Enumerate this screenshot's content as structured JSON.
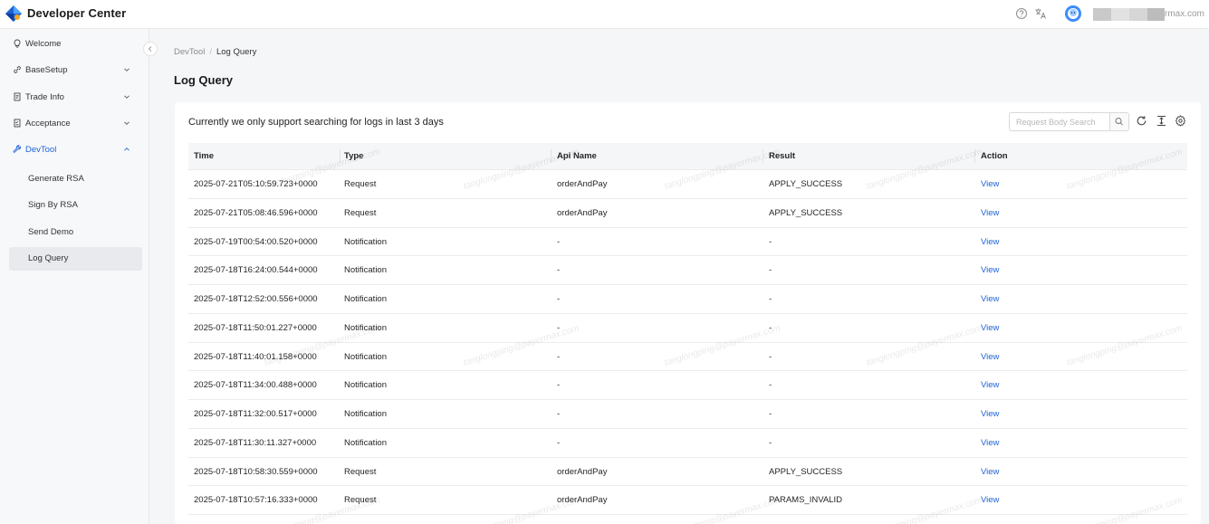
{
  "header": {
    "app_title": "Developer Center",
    "icons": [
      "help-circle-icon",
      "translate-icon",
      "user-avatar-icon"
    ],
    "user_email_suffix": "rmax.com"
  },
  "sidebar": {
    "items": [
      {
        "label": "Welcome",
        "icon": "lightbulb-icon"
      },
      {
        "label": "BaseSetup",
        "icon": "link-icon",
        "expanded": false
      },
      {
        "label": "Trade Info",
        "icon": "document-icon",
        "expanded": false
      },
      {
        "label": "Acceptance",
        "icon": "checklist-icon",
        "expanded": false
      },
      {
        "label": "DevTool",
        "icon": "wrench-icon",
        "expanded": true
      }
    ],
    "sub_items": [
      {
        "label": "Generate RSA"
      },
      {
        "label": "Sign By RSA"
      },
      {
        "label": "Send Demo"
      },
      {
        "label": "Log Query",
        "selected": true
      }
    ]
  },
  "breadcrumb": {
    "parent": "DevTool",
    "separator": "/",
    "current": "Log Query"
  },
  "page_title": "Log Query",
  "notice": "Currently we only support searching for logs in last 3 days",
  "search": {
    "placeholder": "Request Body Search",
    "value": ""
  },
  "colors": {
    "accent": "#1e63d6",
    "avatar": "#3d8bfd",
    "background": "#f5f6f8"
  },
  "watermark": "tanglongping@payermax.com",
  "table": {
    "columns": [
      "Time",
      "Type",
      "Api Name",
      "Result",
      "Action"
    ],
    "rows": [
      {
        "time": "2025-07-21T05:10:59.723+0000",
        "type": "Request",
        "api": "orderAndPay",
        "result": "APPLY_SUCCESS",
        "action": "View"
      },
      {
        "time": "2025-07-21T05:08:46.596+0000",
        "type": "Request",
        "api": "orderAndPay",
        "result": "APPLY_SUCCESS",
        "action": "View"
      },
      {
        "time": "2025-07-19T00:54:00.520+0000",
        "type": "Notification",
        "api": "-",
        "result": "-",
        "action": "View"
      },
      {
        "time": "2025-07-18T16:24:00.544+0000",
        "type": "Notification",
        "api": "-",
        "result": "-",
        "action": "View"
      },
      {
        "time": "2025-07-18T12:52:00.556+0000",
        "type": "Notification",
        "api": "-",
        "result": "-",
        "action": "View"
      },
      {
        "time": "2025-07-18T11:50:01.227+0000",
        "type": "Notification",
        "api": "-",
        "result": "-",
        "action": "View"
      },
      {
        "time": "2025-07-18T11:40:01.158+0000",
        "type": "Notification",
        "api": "-",
        "result": "-",
        "action": "View"
      },
      {
        "time": "2025-07-18T11:34:00.488+0000",
        "type": "Notification",
        "api": "-",
        "result": "-",
        "action": "View"
      },
      {
        "time": "2025-07-18T11:32:00.517+0000",
        "type": "Notification",
        "api": "-",
        "result": "-",
        "action": "View"
      },
      {
        "time": "2025-07-18T11:30:11.327+0000",
        "type": "Notification",
        "api": "-",
        "result": "-",
        "action": "View"
      },
      {
        "time": "2025-07-18T10:58:30.559+0000",
        "type": "Request",
        "api": "orderAndPay",
        "result": "APPLY_SUCCESS",
        "action": "View"
      },
      {
        "time": "2025-07-18T10:57:16.333+0000",
        "type": "Request",
        "api": "orderAndPay",
        "result": "PARAMS_INVALID",
        "action": "View"
      }
    ]
  }
}
